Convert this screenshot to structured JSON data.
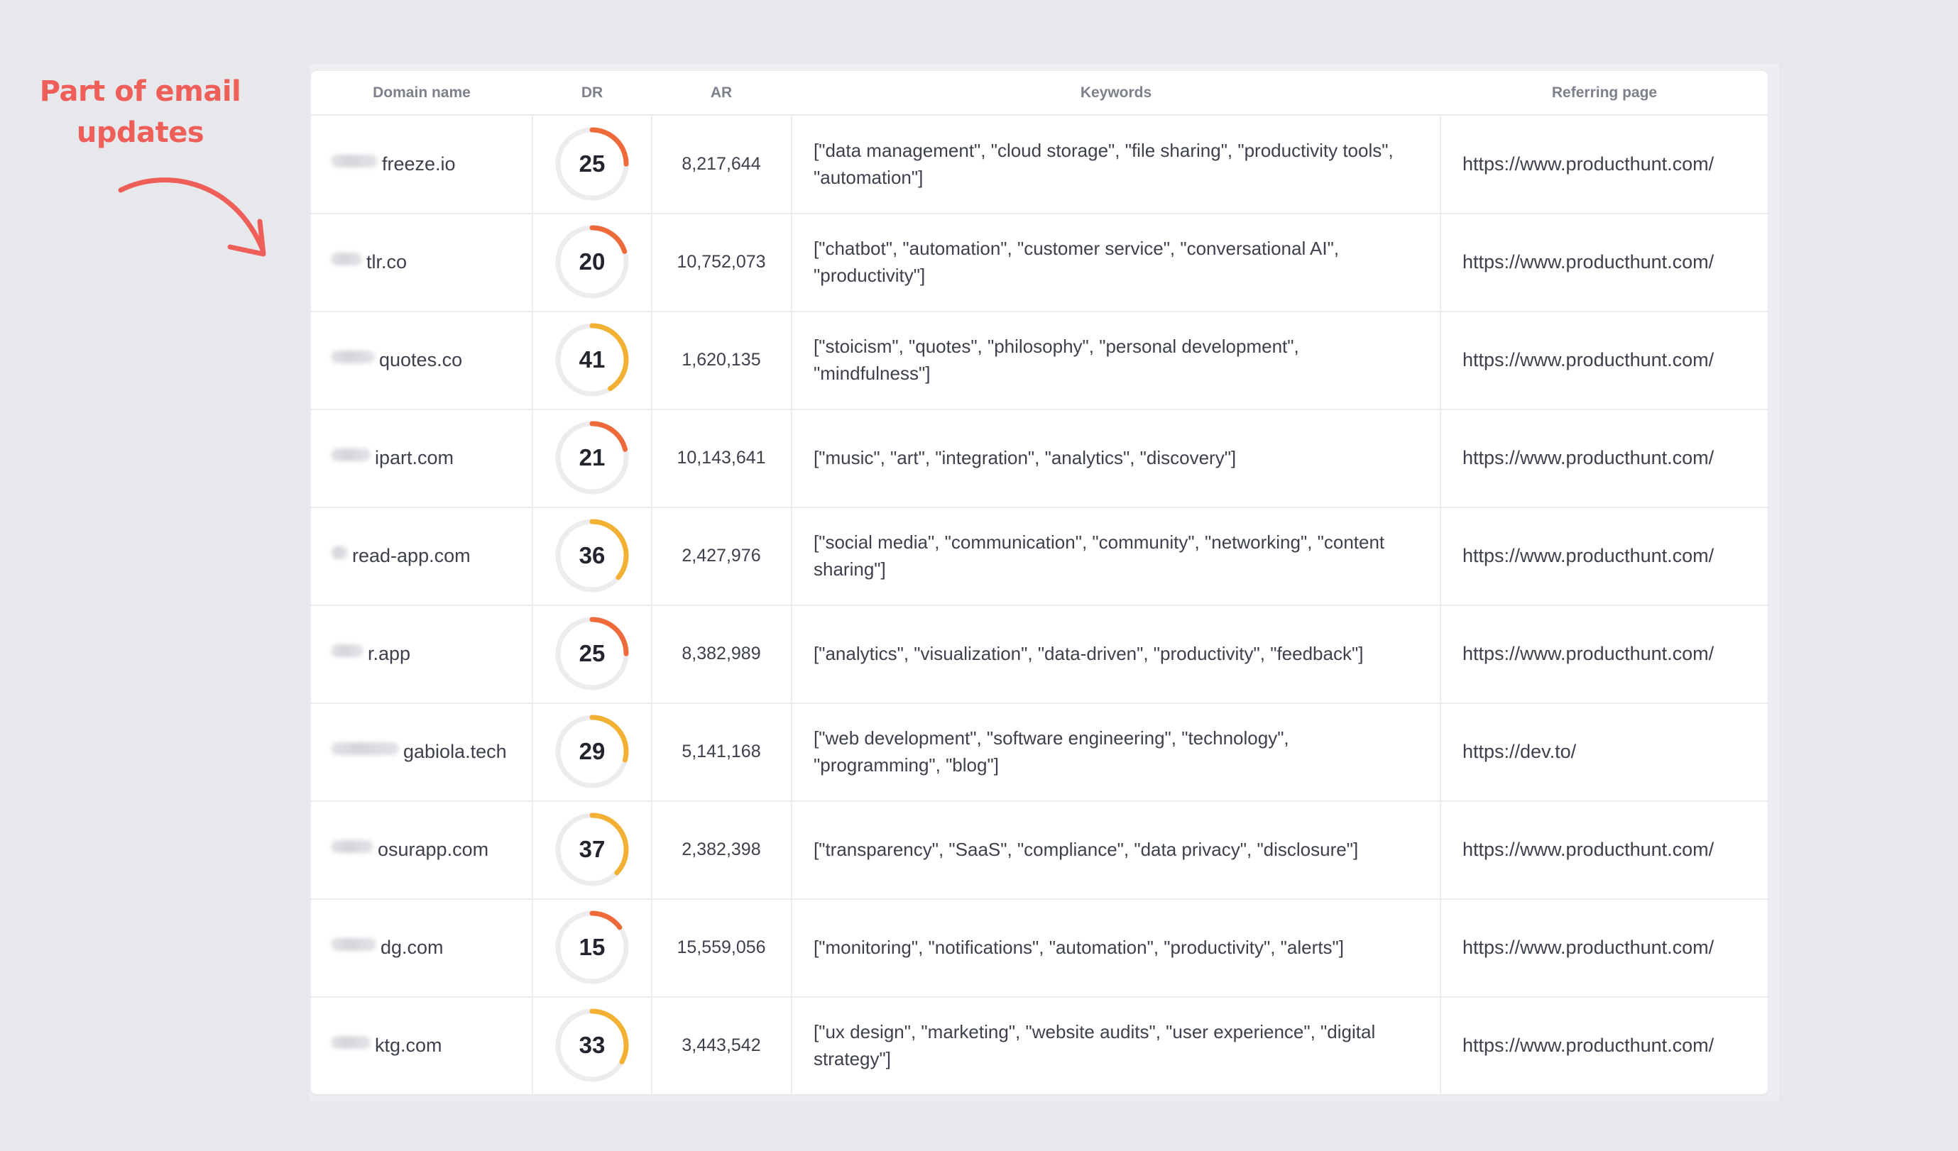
{
  "annotation": {
    "line1": "Part of email",
    "line2": "updates",
    "color": "#ef5f5a"
  },
  "table": {
    "headers": {
      "domain": "Domain name",
      "dr": "DR",
      "ar": "AR",
      "keywords": "Keywords",
      "referring": "Referring page"
    },
    "gauge_colors": {
      "low": "#ee6a3a",
      "mid": "#f2b133",
      "track": "#ececee"
    },
    "rows": [
      {
        "domain": "freeze.io",
        "dr": "25",
        "dr_value": 25,
        "ar": "8,217,644",
        "keywords": "[\"data management\", \"cloud storage\", \"file sharing\", \"productivity tools\", \"automation\"]",
        "referring": "https://www.producthunt.com/"
      },
      {
        "domain": "tlr.co",
        "dr": "20",
        "dr_value": 20,
        "ar": "10,752,073",
        "keywords": "[\"chatbot\", \"automation\", \"customer service\", \"conversational AI\", \"productivity\"]",
        "referring": "https://www.producthunt.com/"
      },
      {
        "domain": "quotes.co",
        "dr": "41",
        "dr_value": 41,
        "ar": "1,620,135",
        "keywords": "[\"stoicism\", \"quotes\", \"philosophy\", \"personal development\", \"mindfulness\"]",
        "referring": "https://www.producthunt.com/"
      },
      {
        "domain": "ipart.com",
        "dr": "21",
        "dr_value": 21,
        "ar": "10,143,641",
        "keywords": "[\"music\", \"art\", \"integration\", \"analytics\", \"discovery\"]",
        "referring": "https://www.producthunt.com/"
      },
      {
        "domain": "read-app.com",
        "dr": "36",
        "dr_value": 36,
        "ar": "2,427,976",
        "keywords": "[\"social media\", \"communication\", \"community\", \"networking\", \"content sharing\"]",
        "referring": "https://www.producthunt.com/"
      },
      {
        "domain": "r.app",
        "dr": "25",
        "dr_value": 25,
        "ar": "8,382,989",
        "keywords": "[\"analytics\", \"visualization\", \"data-driven\", \"productivity\", \"feedback\"]",
        "referring": "https://www.producthunt.com/"
      },
      {
        "domain": "gabiola.tech",
        "dr": "29",
        "dr_value": 29,
        "ar": "5,141,168",
        "keywords": "[\"web development\", \"software engineering\", \"technology\", \"programming\", \"blog\"]",
        "referring": "https://dev.to/"
      },
      {
        "domain": "osurapp.com",
        "dr": "37",
        "dr_value": 37,
        "ar": "2,382,398",
        "keywords": "[\"transparency\", \"SaaS\", \"compliance\", \"data privacy\", \"disclosure\"]",
        "referring": "https://www.producthunt.com/"
      },
      {
        "domain": "dg.com",
        "dr": "15",
        "dr_value": 15,
        "ar": "15,559,056",
        "keywords": "[\"monitoring\", \"notifications\", \"automation\", \"productivity\", \"alerts\"]",
        "referring": "https://www.producthunt.com/"
      },
      {
        "domain": "ktg.com",
        "dr": "33",
        "dr_value": 33,
        "ar": "3,443,542",
        "keywords": "[\"ux design\", \"marketing\", \"website audits\", \"user experience\", \"digital strategy\"]",
        "referring": "https://www.producthunt.com/"
      }
    ]
  }
}
